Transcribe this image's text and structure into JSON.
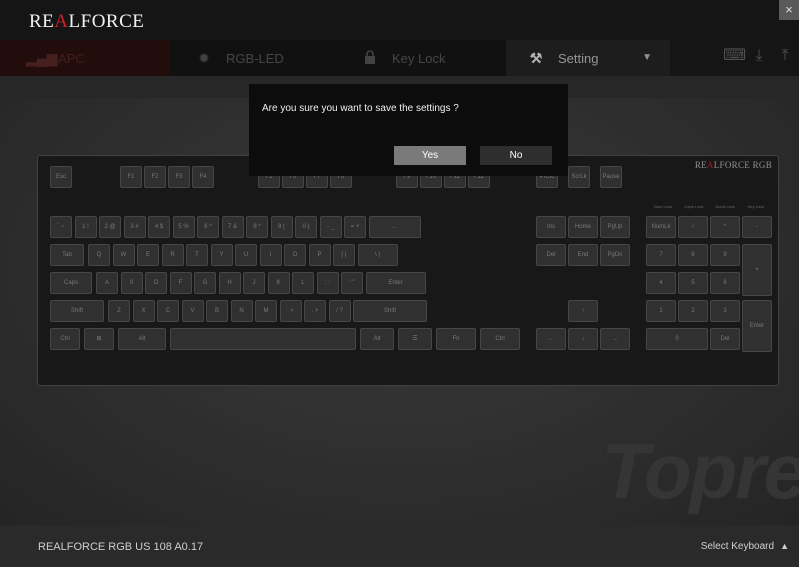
{
  "window": {
    "logo_pre": "RE",
    "logo_mid": "A",
    "logo_post": "LFORCE",
    "close_glyph": "×"
  },
  "tabs": [
    {
      "label": "APC",
      "icon": "apc-icon"
    },
    {
      "label": "RGB-LED",
      "icon": "sun-icon"
    },
    {
      "label": "Key Lock",
      "icon": "lock-icon"
    },
    {
      "label": "Setting",
      "icon": "tools-icon"
    }
  ],
  "toolbar": {
    "icons": [
      "keyboard-download-icon",
      "download-icon",
      "upload-icon"
    ]
  },
  "keyboard_panel": {
    "brand_pre": "RE",
    "brand_mid": "A",
    "brand_post": "LFORCE RGB",
    "indicators": [
      "Num Lock",
      "Caps Lock",
      "Scroll Lock",
      "Key Lock"
    ],
    "rows": [
      [
        "Esc",
        "F1",
        "F2",
        "F3",
        "F4",
        "F5",
        "F6",
        "F7",
        "F8",
        "F9",
        "F10",
        "F11",
        "F12",
        "PrtSc",
        "ScrLk",
        "Pause"
      ],
      [
        "` ~",
        "1 !",
        "2 @",
        "3 #",
        "4 $",
        "5 %",
        "6 ^",
        "7 &",
        "8 *",
        "9 (",
        "0 )",
        "- _",
        "= +",
        "←",
        "Ins",
        "Home",
        "PgUp",
        "NumLk",
        "/",
        "*",
        "-"
      ],
      [
        "Tab",
        "Q",
        "W",
        "E",
        "R",
        "T",
        "Y",
        "U",
        "I",
        "O",
        "P",
        "[ {",
        "] }",
        "\\ |",
        "Del",
        "End",
        "PgDn",
        "7",
        "8",
        "9",
        "+"
      ],
      [
        "Caps",
        "A",
        "S",
        "D",
        "F",
        "G",
        "H",
        "J",
        "K",
        "L",
        "; :",
        "' \"",
        "Enter",
        "4",
        "5",
        "6"
      ],
      [
        "Shift",
        "Z",
        "X",
        "C",
        "V",
        "B",
        "N",
        "M",
        ", <",
        ". >",
        "/ ?",
        "Shift",
        "↑",
        "1",
        "2",
        "3",
        "Enter"
      ],
      [
        "Ctrl",
        "⊞",
        "Alt",
        "",
        "Alt",
        "☰",
        "Fn",
        "Ctrl",
        "←",
        "↓",
        "→",
        "0",
        "Del"
      ]
    ],
    "watermark": "Topre"
  },
  "dialog": {
    "message": "Are you sure you want to save the settings ?",
    "yes_label": "Yes",
    "no_label": "No"
  },
  "statusbar": {
    "model": "REALFORCE RGB US 108  A0.17",
    "select_keyboard": "Select Keyboard",
    "select_glyph": "▲"
  }
}
